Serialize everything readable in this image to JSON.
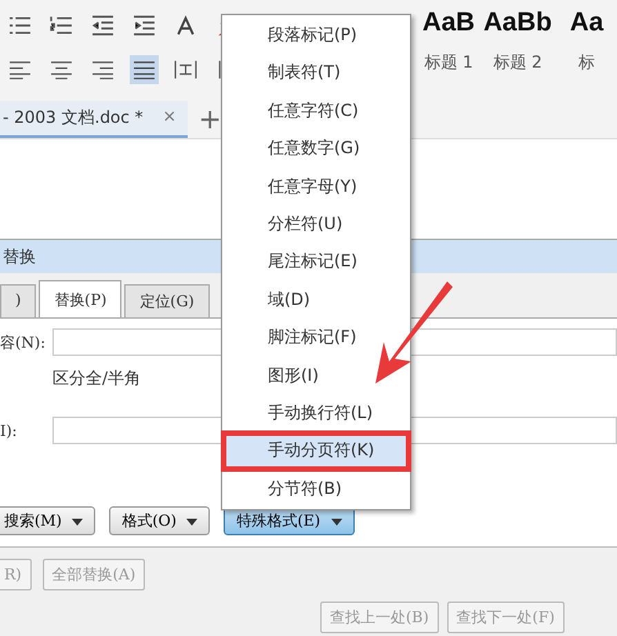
{
  "styles": [
    {
      "sample": "AaB",
      "label": "标题 1"
    },
    {
      "sample": "AaBb",
      "label": "标题 2"
    },
    {
      "sample": "Aa",
      "label": "标"
    }
  ],
  "document_tab": {
    "title": "- 2003 文档.doc *",
    "close": "×",
    "add": "+"
  },
  "dialog": {
    "title": "替换",
    "tabs": [
      {
        "label": ")",
        "selected": false
      },
      {
        "label": "替换(P)",
        "selected": true
      },
      {
        "label": "定位(G)",
        "selected": false
      }
    ],
    "find_label": "容(N):",
    "option": "区分全/半角",
    "replace_label": "I):",
    "buttons": [
      {
        "label": "搜索(M)",
        "active": false
      },
      {
        "label": "格式(O)",
        "active": false
      },
      {
        "label": "特殊格式(E)",
        "active": true
      }
    ],
    "bottom_buttons": [
      "R)",
      "全部替换(A)"
    ],
    "nav_buttons": [
      "查找上一处(B)",
      "查找下一处(F)"
    ]
  },
  "special_menu": [
    {
      "label": "段落标记(P)",
      "selected": false
    },
    {
      "label": "制表符(T)",
      "selected": false
    },
    {
      "label": "任意字符(C)",
      "selected": false
    },
    {
      "label": "任意数字(G)",
      "selected": false
    },
    {
      "label": "任意字母(Y)",
      "selected": false
    },
    {
      "label": "分栏符(U)",
      "selected": false
    },
    {
      "label": "尾注标记(E)",
      "selected": false
    },
    {
      "label": "域(D)",
      "selected": false
    },
    {
      "label": "脚注标记(F)",
      "selected": false
    },
    {
      "label": "图形(I)",
      "selected": false
    },
    {
      "label": "手动换行符(L)",
      "selected": false
    },
    {
      "label": "手动分页符(K)",
      "selected": true
    },
    {
      "label": "分节符(B)",
      "selected": false
    }
  ]
}
